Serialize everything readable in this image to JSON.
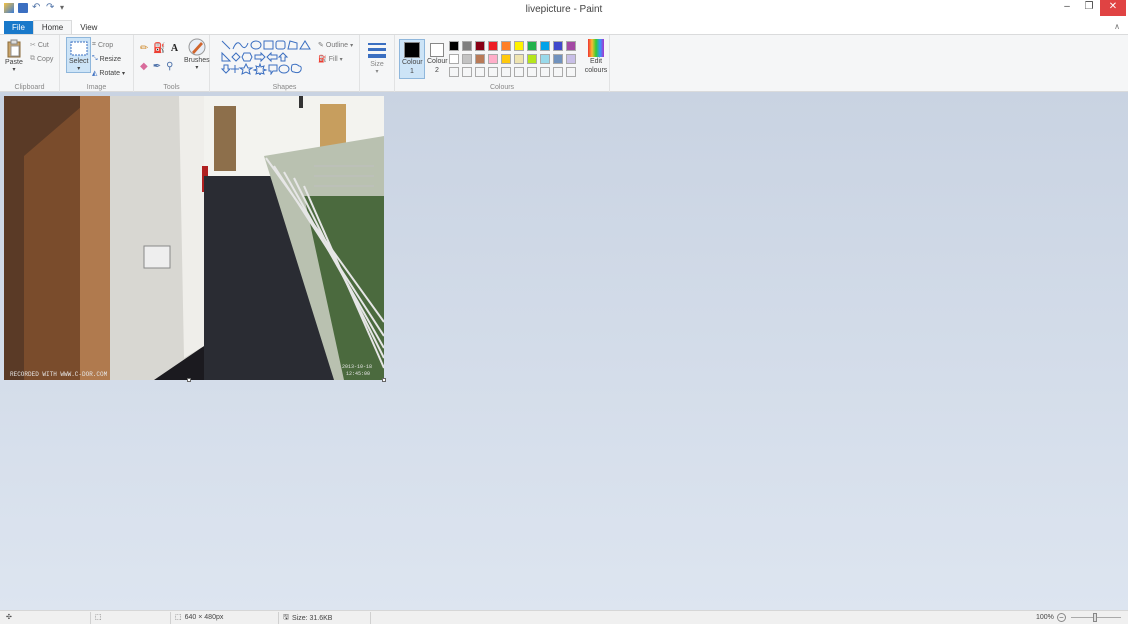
{
  "window": {
    "title": "livepicture - Paint"
  },
  "tabs": [
    {
      "label": "File"
    },
    {
      "label": "Home"
    },
    {
      "label": "View"
    }
  ],
  "ribbon": {
    "clipboard": {
      "label": "Clipboard",
      "paste": "Paste",
      "cut": "Cut",
      "copy": "Copy"
    },
    "image": {
      "label": "Image",
      "select": "Select",
      "crop": "Crop",
      "resize": "Resize",
      "rotate": "Rotate"
    },
    "tools": {
      "label": "Tools",
      "brushes": "Brushes"
    },
    "shapes": {
      "label": "Shapes",
      "outline": "Outline",
      "fill": "Fill"
    },
    "size": {
      "label": "Size"
    },
    "colours": {
      "label": "Colours",
      "colour1": "Colour 1",
      "colour2": "Colour 2",
      "edit": "Edit colours",
      "palette_row1": [
        "#000000",
        "#7f7f7f",
        "#880015",
        "#ed1c24",
        "#ff7f27",
        "#fff200",
        "#22b14c",
        "#00a2e8",
        "#3f48cc",
        "#a349a4"
      ],
      "palette_row2": [
        "#ffffff",
        "#c3c3c3",
        "#b97a57",
        "#ffaec9",
        "#ffc90e",
        "#efe4b0",
        "#b5e61d",
        "#99d9ea",
        "#7092be",
        "#c8bfe7"
      ]
    }
  },
  "canvas": {
    "watermark_left": "RECORDED WITH WWW.C-DOR.COM",
    "timestamp_line1": "2013-10-18",
    "timestamp_line2": "12:45:00"
  },
  "status": {
    "dimensions": "640 × 480px",
    "size": "Size: 31.6KB",
    "zoom": "100%"
  }
}
